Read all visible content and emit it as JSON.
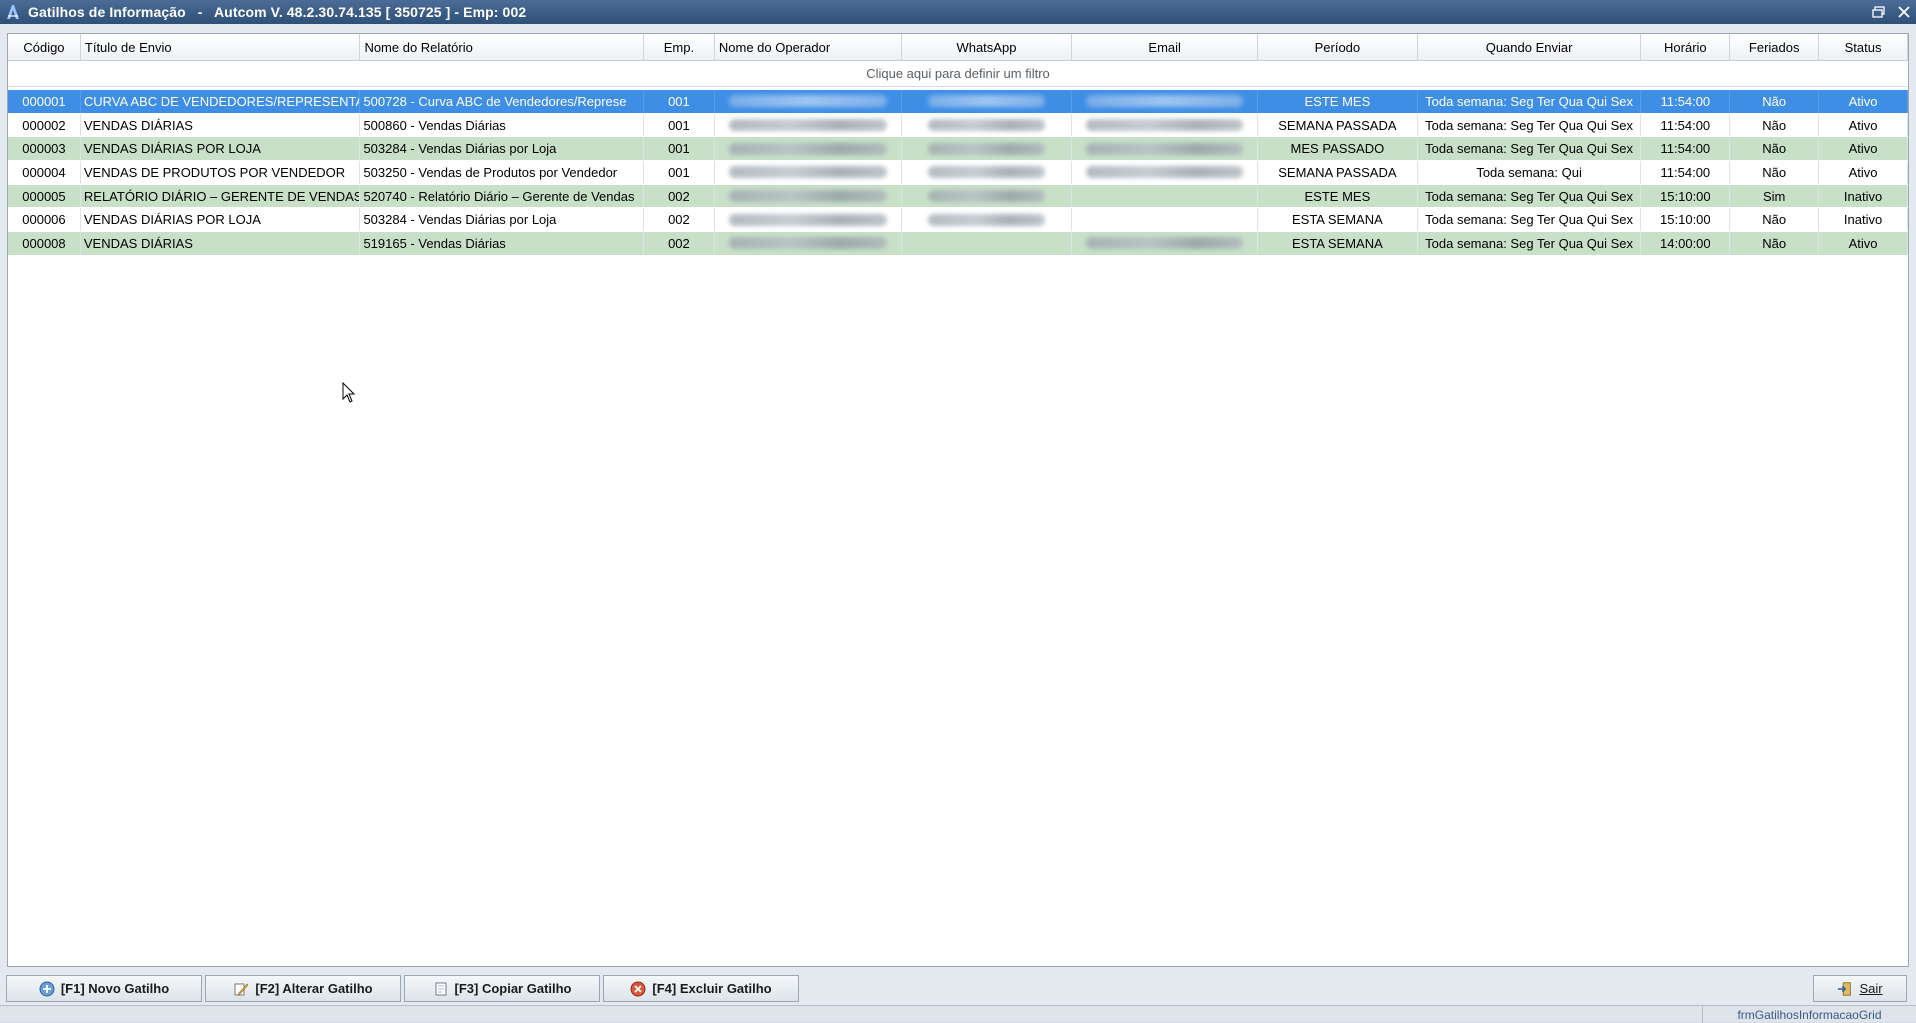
{
  "window": {
    "title": "Gatilhos de Informação   -   Autcom V. 48.2.30.74.135 [ 350725 ] - Emp: 002"
  },
  "grid": {
    "columns": [
      {
        "key": "codigo",
        "label": "Código"
      },
      {
        "key": "titulo",
        "label": "Título de Envio"
      },
      {
        "key": "relatorio",
        "label": "Nome do Relatório"
      },
      {
        "key": "emp",
        "label": "Emp."
      },
      {
        "key": "operador",
        "label": "Nome do Operador"
      },
      {
        "key": "whatsapp",
        "label": "WhatsApp"
      },
      {
        "key": "email",
        "label": "Email"
      },
      {
        "key": "periodo",
        "label": "Período"
      },
      {
        "key": "quando",
        "label": "Quando Enviar"
      },
      {
        "key": "horario",
        "label": "Horário"
      },
      {
        "key": "feriados",
        "label": "Feriados"
      },
      {
        "key": "status",
        "label": "Status"
      }
    ],
    "filter_hint": "Clique aqui para definir um filtro",
    "rows": [
      {
        "codigo": "000001",
        "titulo": "CURVA ABC DE VENDEDORES/REPRESENTA",
        "relatorio": "500728 - Curva ABC de Vendedores/Represe",
        "emp": "001",
        "periodo": "ESTE MES",
        "quando": "Toda semana: Seg Ter Qua Qui Sex",
        "horario": "11:54:00",
        "feriados": "Não",
        "status": "Ativo"
      },
      {
        "codigo": "000002",
        "titulo": "VENDAS DIÁRIAS",
        "relatorio": "500860 - Vendas Diárias",
        "emp": "001",
        "periodo": "SEMANA PASSADA",
        "quando": "Toda semana: Seg Ter Qua Qui Sex",
        "horario": "11:54:00",
        "feriados": "Não",
        "status": "Ativo"
      },
      {
        "codigo": "000003",
        "titulo": "VENDAS DIÁRIAS POR LOJA",
        "relatorio": "503284 - Vendas Diárias por Loja",
        "emp": "001",
        "periodo": "MES PASSADO",
        "quando": "Toda semana: Seg Ter Qua Qui Sex",
        "horario": "11:54:00",
        "feriados": "Não",
        "status": "Ativo"
      },
      {
        "codigo": "000004",
        "titulo": "VENDAS DE PRODUTOS POR VENDEDOR",
        "relatorio": "503250 - Vendas de Produtos por Vendedor",
        "emp": "001",
        "periodo": "SEMANA PASSADA",
        "quando": "Toda semana: Qui",
        "horario": "11:54:00",
        "feriados": "Não",
        "status": "Ativo"
      },
      {
        "codigo": "000005",
        "titulo": "RELATÓRIO DIÁRIO – GERENTE DE VENDAS",
        "relatorio": "520740 - Relatório Diário – Gerente de Vendas",
        "emp": "002",
        "periodo": "ESTE MES",
        "quando": "Toda semana: Seg Ter Qua Qui Sex",
        "horario": "15:10:00",
        "feriados": "Sim",
        "status": "Inativo"
      },
      {
        "codigo": "000006",
        "titulo": "VENDAS DIÁRIAS POR LOJA",
        "relatorio": "503284 - Vendas Diárias por Loja",
        "emp": "002",
        "periodo": "ESTA SEMANA",
        "quando": "Toda semana: Seg Ter Qua Qui Sex",
        "horario": "15:10:00",
        "feriados": "Não",
        "status": "Inativo"
      },
      {
        "codigo": "000008",
        "titulo": "VENDAS DIÁRIAS",
        "relatorio": "519165 - Vendas Diárias",
        "emp": "002",
        "periodo": "ESTA SEMANA",
        "quando": "Toda semana: Seg Ter Qua Qui Sex",
        "horario": "14:00:00",
        "feriados": "Não",
        "status": "Ativo"
      }
    ]
  },
  "toolbar": {
    "novo": "[F1] Novo Gatilho",
    "alterar": "[F2] Alterar Gatilho",
    "copiar": "[F3] Copiar Gatilho",
    "excluir": "[F4] Excluir Gatilho",
    "sair": "Sair"
  },
  "statusbar": {
    "form_name": "frmGatilhosInformacaoGrid"
  },
  "colors": {
    "selected_row": "#3f8ee6",
    "alt_row": "#c8e0c8",
    "titlebar": "#2f5077"
  }
}
